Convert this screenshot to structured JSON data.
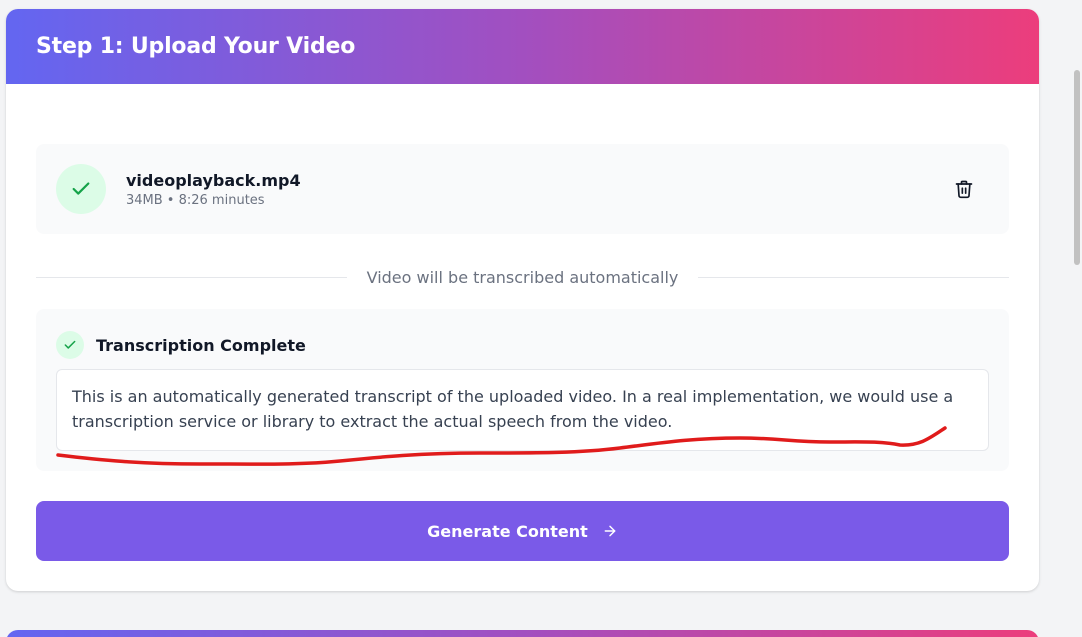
{
  "header": {
    "title": "Step 1: Upload Your Video"
  },
  "file": {
    "name": "videoplayback.mp4",
    "meta": "34MB • 8:26 minutes",
    "status_icon": "check-icon",
    "delete_icon": "trash-icon"
  },
  "divider": {
    "text": "Video will be transcribed automatically"
  },
  "transcription": {
    "title": "Transcription Complete",
    "text": "This is an automatically generated transcript of the uploaded video. In a real implementation, we would use a transcription service or library to extract the actual speech from the video."
  },
  "generate_button": {
    "label": "Generate Content",
    "icon": "arrow-right-icon"
  },
  "colors": {
    "header_gradient_start": "#6366f1",
    "header_gradient_mid": "#a24fc0",
    "header_gradient_end": "#ec3d7c",
    "button": "#7a5ae8",
    "success": "#16a34a",
    "success_bg": "#dcfce7",
    "annotation": "#e01b1b"
  }
}
